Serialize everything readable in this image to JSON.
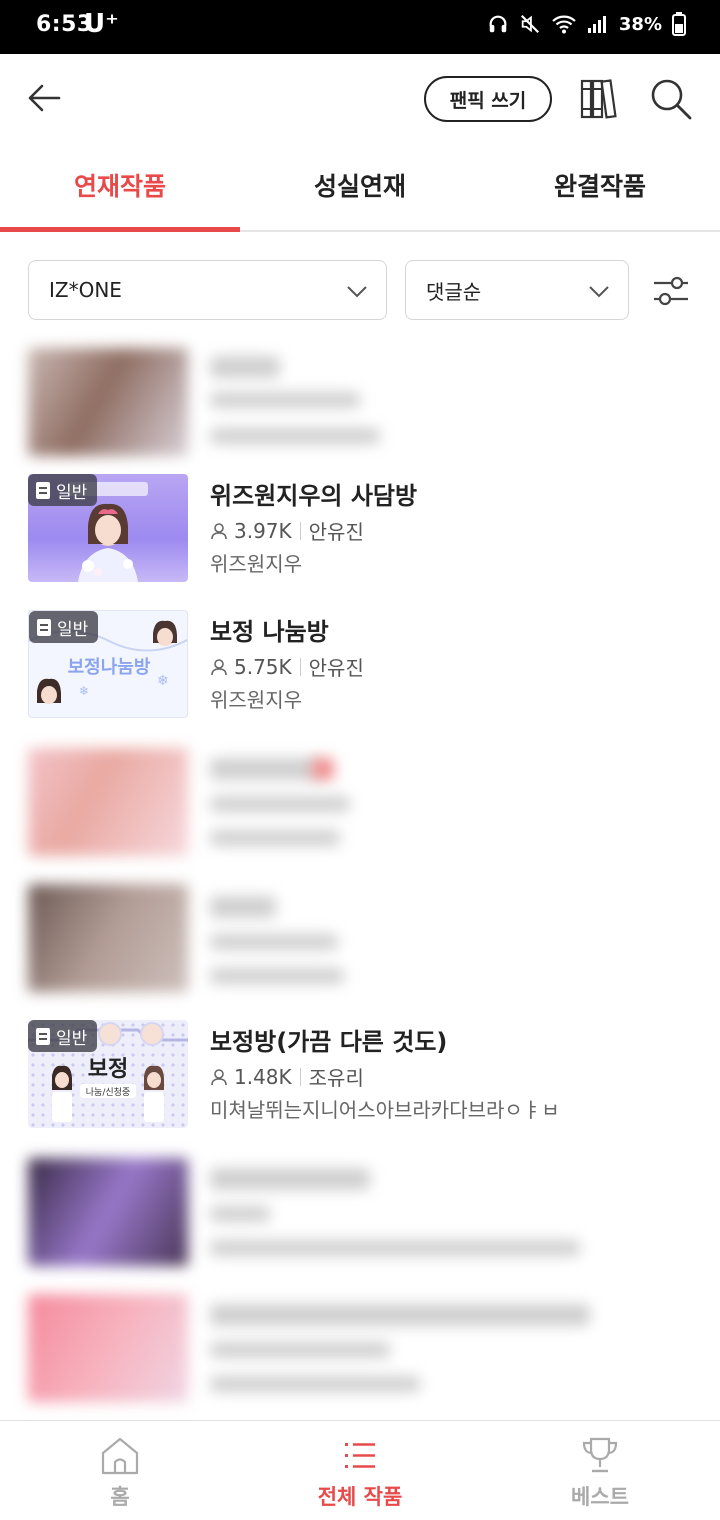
{
  "status_bar": {
    "time": "6:53",
    "carrier": "U⁺",
    "battery": "38%"
  },
  "header": {
    "write_label": "팬픽 쓰기"
  },
  "tabs": [
    {
      "label": "연재작품",
      "active": true
    },
    {
      "label": "성실연재",
      "active": false
    },
    {
      "label": "완결작품",
      "active": false
    }
  ],
  "filters": {
    "group": "IZ*ONE",
    "sort": "댓글순"
  },
  "list": [
    {
      "blurred": true
    },
    {
      "badge": "일반",
      "title": "위즈원지우의 사담방",
      "views": "3.97K",
      "author": "안유진",
      "writer": "위즈원지우"
    },
    {
      "badge": "일반",
      "title": "보정 나눔방",
      "views": "5.75K",
      "author": "안유진",
      "writer": "위즈원지우",
      "thumb_text": "보정나눔방"
    },
    {
      "blurred": true
    },
    {
      "blurred": true
    },
    {
      "badge": "일반",
      "title": "보정방(가끔 다른 것도)",
      "views": "1.48K",
      "author": "조유리",
      "writer": "미쳐날뛰는지니어스아브라카다브라ㅇㅑㅂ",
      "thumb_text": "보정",
      "thumb_sub": "나눔/신청중"
    },
    {
      "blurred": true
    },
    {
      "blurred": true
    }
  ],
  "bottom_nav": [
    {
      "label": "홈",
      "icon": "home-icon",
      "active": false
    },
    {
      "label": "전체 작품",
      "icon": "list-icon",
      "active": true
    },
    {
      "label": "베스트",
      "icon": "trophy-icon",
      "active": false
    }
  ],
  "colors": {
    "accent": "#e84a4a",
    "text": "#222222",
    "muted": "#aaaaaa"
  }
}
